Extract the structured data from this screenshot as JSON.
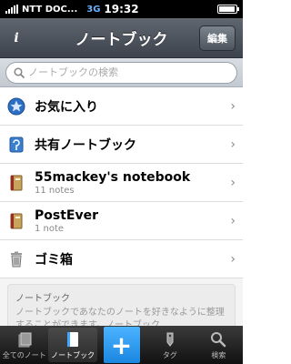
{
  "status_bar": {
    "carrier": "NTT DOC...",
    "network": "3G",
    "time": "19:32"
  },
  "nav": {
    "title": "ノートブック",
    "edit_label": "編集",
    "info_label": "i"
  },
  "search": {
    "placeholder": "ノートブックの検索"
  },
  "list": {
    "items": [
      {
        "label": "お気に入り",
        "sub": "",
        "icon": "star-icon"
      },
      {
        "label": "共有ノートブック",
        "sub": "",
        "icon": "shared-notebook-icon"
      },
      {
        "label": "55mackey's notebook",
        "sub": "11 notes",
        "icon": "notebook-icon"
      },
      {
        "label": "PostEver",
        "sub": "1 note",
        "icon": "notebook-icon"
      },
      {
        "label": "ゴミ箱",
        "sub": "",
        "icon": "trash-icon"
      }
    ]
  },
  "info_panel": {
    "title": "ノートブック",
    "body": "ノートブックであなたのノートを好きなように整理することができます。ノートブック"
  },
  "tab_bar": {
    "tabs": [
      {
        "label": "全てのノート",
        "icon": "all-notes-icon"
      },
      {
        "label": "ノートブック",
        "icon": "notebook-icon"
      },
      {
        "label": "",
        "icon": "plus-icon"
      },
      {
        "label": "タグ",
        "icon": "tag-icon"
      },
      {
        "label": "検索",
        "icon": "search-icon"
      }
    ]
  },
  "colors": {
    "nav_dark": "#3c434c",
    "accent_blue": "#1a86e0"
  }
}
